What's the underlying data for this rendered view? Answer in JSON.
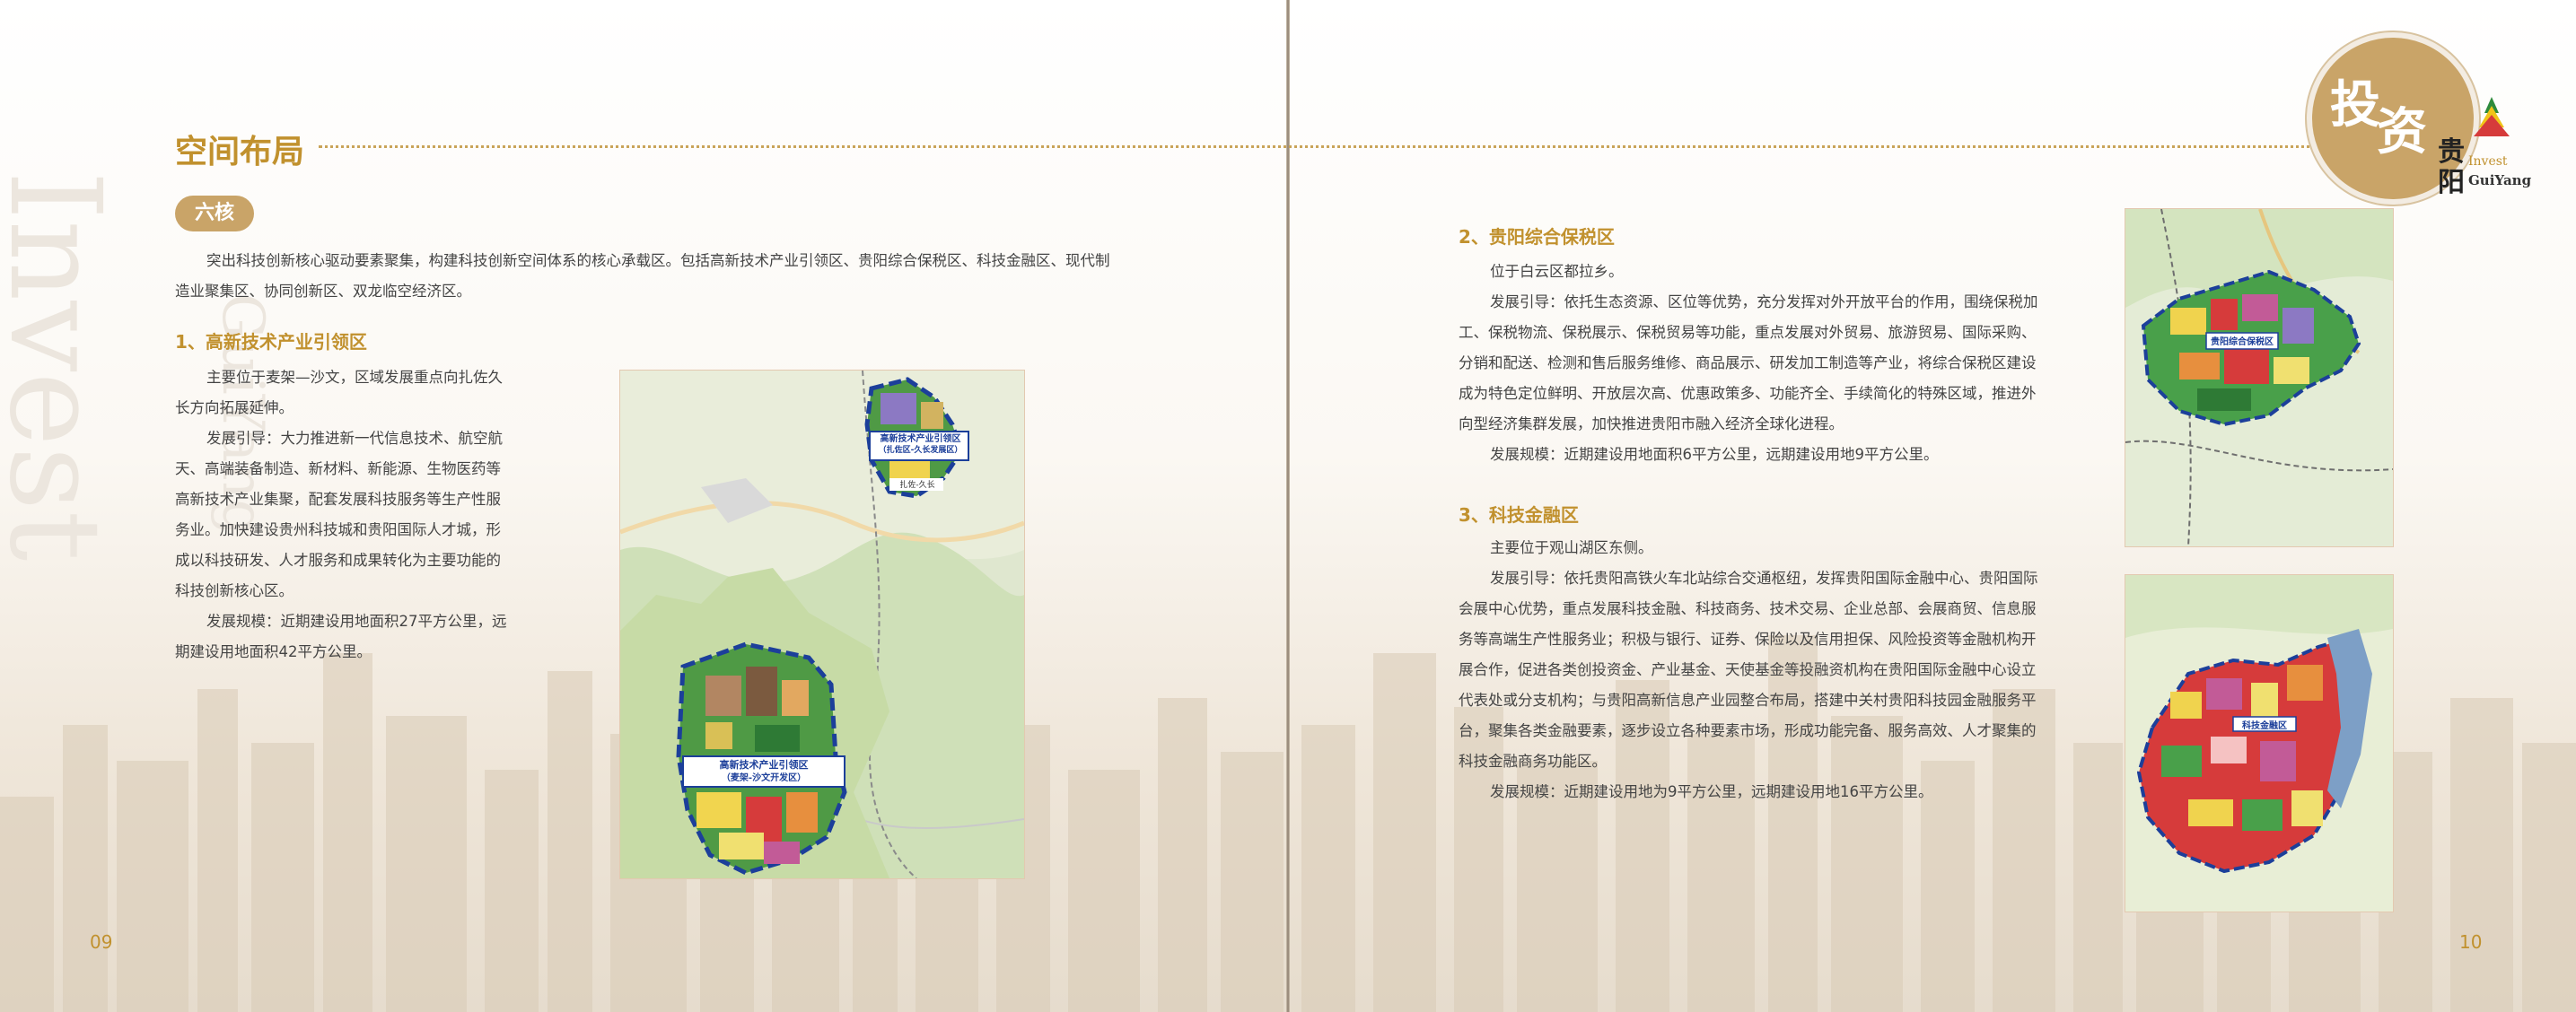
{
  "watermark": {
    "large": "Invest",
    "small": "GuiYang"
  },
  "left_page": {
    "section_title": "空间布局",
    "badge": "六核",
    "intro": [
      "突出科技创新核心驱动要素聚集，构建科技创新空间体系的核心承载区。包括高新技术产业引领区、贵阳综合保税区、科技金融区、现代制",
      "造业聚集区、协同创新区、双龙临空经济区。"
    ],
    "sub1": {
      "title": "1、高新技术产业引领区",
      "lines": [
        "主要位于麦架—沙文，区域发展重点向扎佐久",
        "长方向拓展延伸。",
        "发展引导：大力推进新一代信息技术、航空航",
        "天、高端装备制造、新材料、新能源、生物医药等",
        "高新技术产业集聚，配套发展科技服务等生产性服",
        "务业。加快建设贵州科技城和贵阳国际人才城，形",
        "成以科技研发、人才服务和成果转化为主要功能的",
        "科技创新核心区。",
        "发展规模：近期建设用地面积27平方公里，远",
        "期建设用地面积42平方公里。"
      ]
    },
    "map_labels": {
      "north_a": "高新技术产业引领区",
      "north_b": "（扎佐区-久长发展区）",
      "north_c": "扎佐-久长",
      "south_a": "高新技术产业引领区",
      "south_b": "（麦架-沙文开发区）"
    },
    "page_number": "09"
  },
  "right_page": {
    "sub2": {
      "title": "2、贵阳综合保税区",
      "lines": [
        "位于白云区都拉乡。",
        "发展引导：依托生态资源、区位等优势，充分发挥对外开放平台的作用，围绕保税加",
        "工、保税物流、保税展示、保税贸易等功能，重点发展对外贸易、旅游贸易、国际采购、",
        "分销和配送、检测和售后服务维修、商品展示、研发加工制造等产业，将综合保税区建设",
        "成为特色定位鲜明、开放层次高、优惠政策多、功能齐全、手续简化的特殊区域，推进外",
        "向型经济集群发展，加快推进贵阳市融入经济全球化进程。",
        "发展规模：近期建设用地面积6平方公里，远期建设用地9平方公里。"
      ]
    },
    "sub3": {
      "title": "3、科技金融区",
      "lines": [
        "主要位于观山湖区东侧。",
        "发展引导：依托贵阳高铁火车北站综合交通枢纽，发挥贵阳国际金融中心、贵阳国际",
        "会展中心优势，重点发展科技金融、科技商务、技术交易、企业总部、会展商贸、信息服",
        "务等高端生产性服务业；积极与银行、证券、保险以及信用担保、风险投资等金融机构开",
        "展合作，促进各类创投资金、产业基金、天使基金等投融资机构在贵阳国际金融中心设立",
        "代表处或分支机构；与贵阳高新信息产业园整合布局，搭建中关村贵阳科技园金融服务平",
        "台，聚集各类金融要素，逐步设立各种要素市场，形成功能完备、服务高效、人才聚集的",
        "科技金融商务功能区。",
        "发展规模：近期建设用地为9平方公里，远期建设用地16平方公里。"
      ]
    },
    "map2_label": "贵阳综合保税区",
    "map3_label": "科技金融区",
    "page_number": "10"
  },
  "logo": {
    "char1": "投",
    "char2": "资",
    "cn1": "贵",
    "cn2": "阳",
    "en1": "Invest",
    "en2": "GuiYang"
  },
  "colors": {
    "gold": "#c1912e",
    "badge": "#c9a468",
    "boundary": "#1c3f9a"
  }
}
